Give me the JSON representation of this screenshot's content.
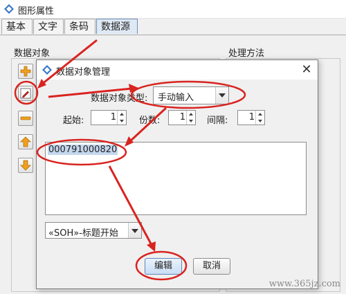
{
  "window": {
    "title": "图形属性"
  },
  "tabs": [
    {
      "label": "基本"
    },
    {
      "label": "文字"
    },
    {
      "label": "条码"
    },
    {
      "label": "数据源"
    }
  ],
  "panel": {
    "data_object_label": "数据对象",
    "process_label": "处理方法"
  },
  "side_buttons": [
    "add-icon",
    "edit-icon",
    "remove-icon",
    "move-up-icon",
    "move-down-icon"
  ],
  "dialog": {
    "title": "数据对象管理",
    "type_label": "数据对象类型:",
    "type_value": "手动输入",
    "start_label": "起始:",
    "start_value": "1",
    "copies_label": "份数:",
    "copies_value": "1",
    "interval_label": "间隔:",
    "interval_value": "1",
    "data_value": "000791000820",
    "control_select": "«SOH»-标题开始",
    "edit_button": "编辑",
    "cancel_button": "取消"
  },
  "watermark": "www.365jz.com",
  "colors": {
    "annotation": "#d9231f",
    "selection": "#c4d7ef",
    "accent_blue": "#3a78c8"
  }
}
